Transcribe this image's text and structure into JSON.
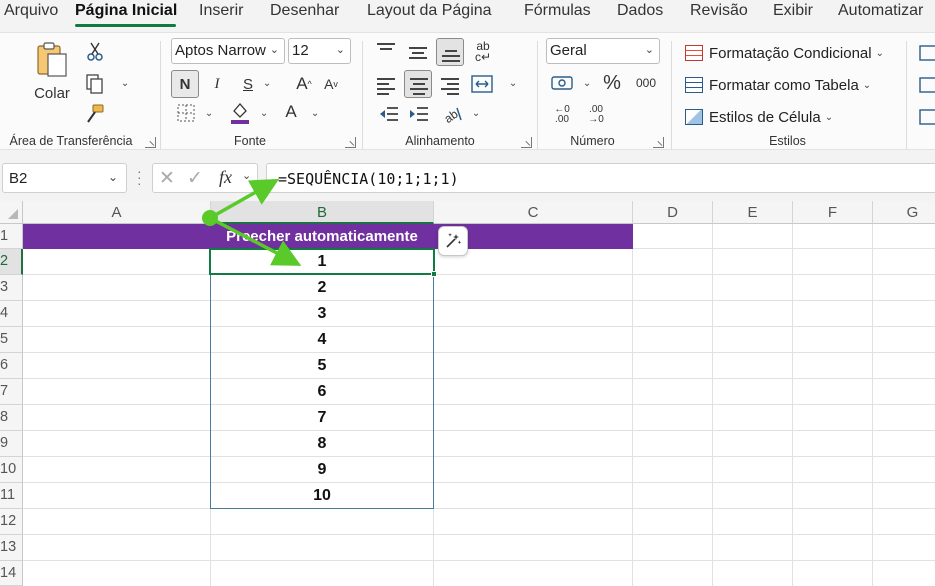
{
  "menu_tabs": [
    "Arquivo",
    "Página Inicial",
    "Inserir",
    "Desenhar",
    "Layout da Página",
    "Fórmulas",
    "Dados",
    "Revisão",
    "Exibir",
    "Automatizar"
  ],
  "ribbon": {
    "clipboard": {
      "paste_label": "Colar",
      "group_label": "Área de Transferência"
    },
    "font": {
      "font_name": "Aptos Narrow",
      "font_size": "12",
      "bold": "N",
      "italic": "I",
      "underline": "S",
      "grow": "A",
      "shrink": "A",
      "color_a": "A",
      "group_label": "Fonte"
    },
    "alignment": {
      "group_label": "Alinhamento"
    },
    "number": {
      "format": "Geral",
      "currency": "$",
      "percent": "%",
      "thousands": "000",
      "group_label": "Número"
    },
    "styles": {
      "conditional": "Formatação Condicional",
      "table": "Formatar como Tabela",
      "cell_styles": "Estilos de Célula",
      "group_label": "Estilos"
    },
    "colors": {
      "accent": "#0f7b3d",
      "font_color_bar": "#7030a0"
    }
  },
  "formula_bar": {
    "name_box": "B2",
    "fx": "fx",
    "formula": "=SEQUÊNCIA(10;1;1;1)"
  },
  "sheet": {
    "columns": [
      "A",
      "B",
      "C",
      "D",
      "E",
      "F",
      "G"
    ],
    "selected_column": "B",
    "rows": [
      "1",
      "2",
      "3",
      "4",
      "5",
      "6",
      "7",
      "8",
      "9",
      "10",
      "11",
      "12",
      "13",
      "14"
    ],
    "selected_row": "2",
    "header_text": "Preecher automaticamente",
    "header_color": "#7030a0",
    "values": [
      "1",
      "2",
      "3",
      "4",
      "5",
      "6",
      "7",
      "8",
      "9",
      "10"
    ],
    "arrow_color": "#5ac92a"
  }
}
